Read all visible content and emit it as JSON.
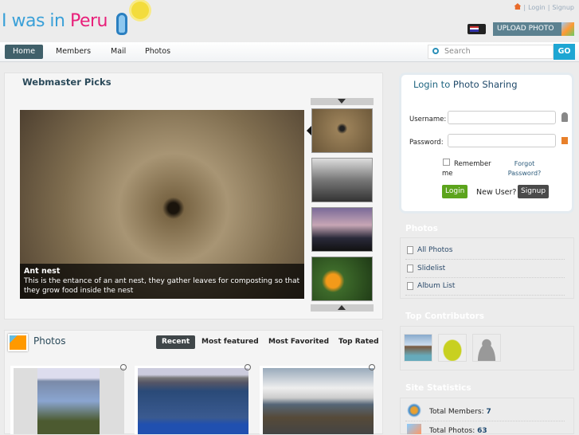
{
  "header": {
    "logo_part1": "I was in ",
    "logo_part2": "Peru",
    "login": "Login",
    "signup": "Signup",
    "sep": "|",
    "upload": "UPLOAD PHOTO"
  },
  "nav": {
    "items": [
      "Home",
      "Members",
      "Mail",
      "Photos"
    ],
    "search_placeholder": "Search",
    "go": "GO"
  },
  "picks": {
    "title": "Webmaster Picks",
    "caption_title": "Ant nest",
    "caption_text": "This is the entance of an ant nest, they gather leaves for composting so that they grow food inside the nest"
  },
  "photos": {
    "title": "Photos",
    "tabs": [
      "Recent",
      "Most featured",
      "Most Favorited",
      "Top Rated"
    ]
  },
  "login": {
    "title_a": "Login to ",
    "title_b": "Photo Sharing",
    "username": "Username:",
    "password": "Password:",
    "remember": "Remember me",
    "forgot": "Forgot Password?",
    "login_btn": "Login",
    "new_user": "New User?",
    "signup_btn": "Signup"
  },
  "sidebar": {
    "photos_title": "Photos",
    "links": [
      "All Photos",
      "Slidelist",
      "Album List"
    ],
    "contributors_title": "Top Contributors",
    "stats_title": "Site Statistics",
    "members_label": "Total Members: ",
    "members": "7",
    "photos_label": "Total Photos: ",
    "photos": "63"
  }
}
